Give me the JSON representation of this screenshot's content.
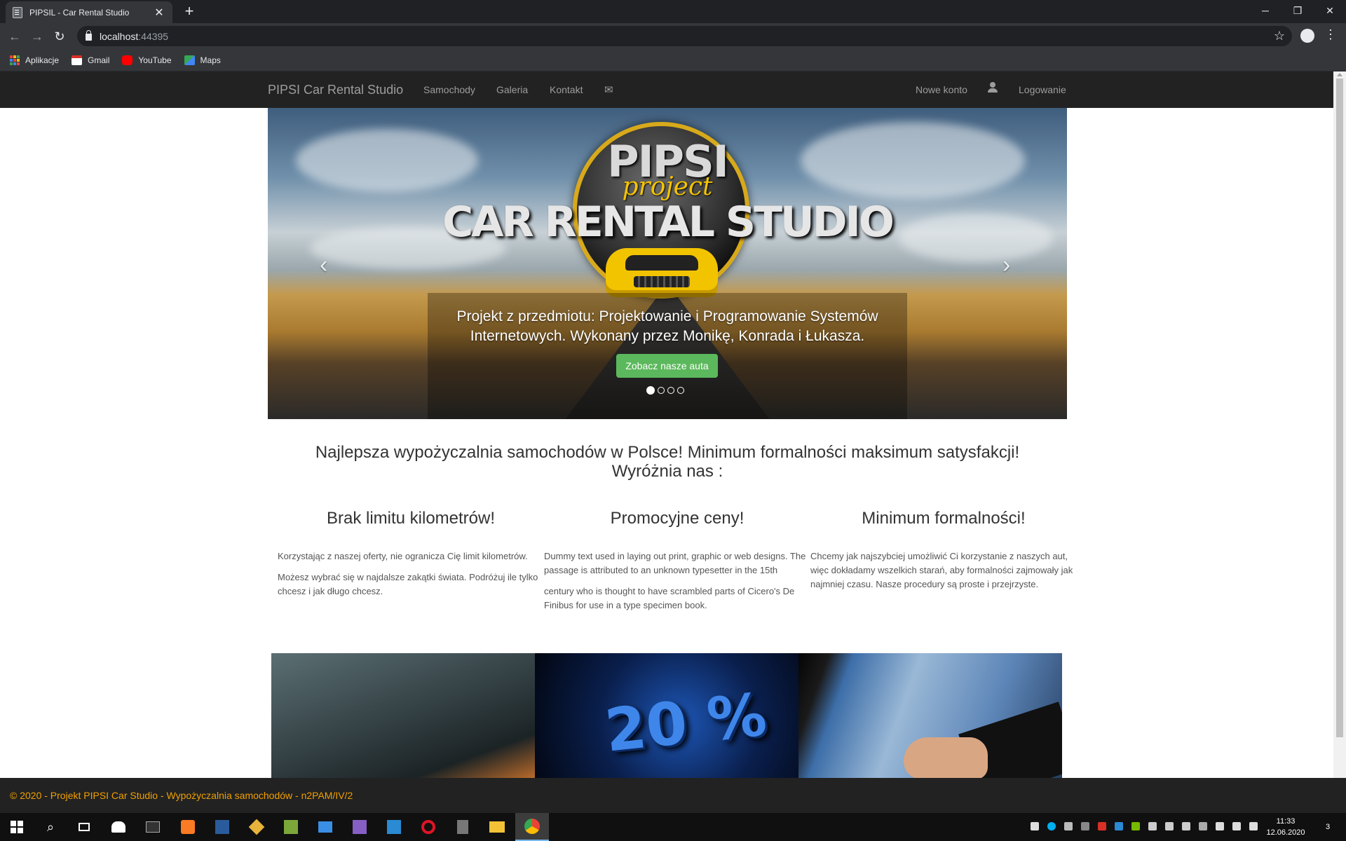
{
  "browser": {
    "tab_title": "PIPSIL - Car Rental Studio",
    "tab_close": "✕",
    "new_tab": "+",
    "url_host": "localhost",
    "url_port": ":44395",
    "window_controls": [
      "─",
      "❐",
      "✕"
    ],
    "bookmarks": [
      "Aplikacje",
      "Gmail",
      "YouTube",
      "Maps"
    ]
  },
  "navbar": {
    "brand": "PIPSI Car Rental Studio",
    "links": [
      "Samochody",
      "Galeria",
      "Kontakt"
    ],
    "envelope": "✉",
    "register": "Nowe konto",
    "login": "Logowanie"
  },
  "carousel": {
    "logo_line1": "PIPSI",
    "logo_line2": "project",
    "logo_line3": "CAR RENTAL STUDIO",
    "caption": "Projekt z przedmiotu: Projektowanie i Programowanie Systemów Internetowych. Wykonany przez Monikę, Konrada i Łukasza.",
    "button": "Zobacz nasze auta",
    "prev": "‹",
    "next": "›",
    "slides": 4,
    "active_slide": 1
  },
  "tagline": {
    "line1": "Najlepsza wypożyczalnia samochodów w Polsce! Minimum formalności maksimum satysfakcji!",
    "line2": "Wyróżnia nas :"
  },
  "features": [
    {
      "title": "Brak limitu kilometrów!",
      "p1": "Korzystając z naszej oferty, nie ogranicza Cię limit kilometrów.",
      "p2": "Możesz wybrać się w najdalsze zakątki świata. Podróżuj ile tylko chcesz i jak długo chcesz."
    },
    {
      "title": "Promocyjne ceny!",
      "p1": "Dummy text used in laying out print, graphic or web designs. The passage is attributed to an unknown typesetter in the 15th",
      "p2": "century who is thought to have scrambled parts of Cicero's De Finibus for use in a type specimen book."
    },
    {
      "title": "Minimum formalności!",
      "p1": "Chcemy jak najszybciej umożliwić Ci korzystanie z naszych aut, więc dokładamy wszelkich starań, aby formalności zajmowały jak najmniej czasu. Nasze procedury są proste i przejrzyste.",
      "p2": ""
    }
  ],
  "images": {
    "promo_text": "20 %"
  },
  "footer": {
    "text": "© 2020 - Projekt PIPSI Car Studio - Wypożyczalnia samochodów - n2PAM/IV/2"
  },
  "taskbar": {
    "time": "11:33",
    "date": "12.06.2020",
    "notifications": "3"
  },
  "colors": {
    "navbar": "#222222",
    "cta": "#5cb85c",
    "footer_text": "#f0a000"
  }
}
